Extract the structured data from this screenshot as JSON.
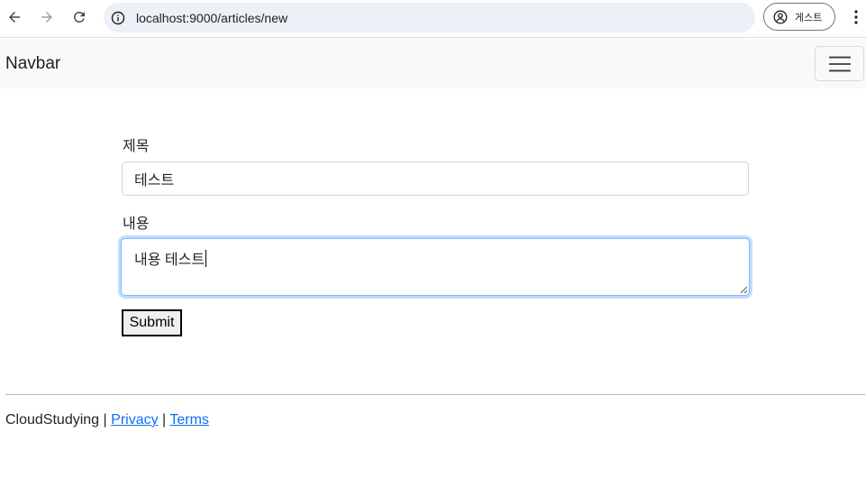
{
  "browser": {
    "url": "localhost:9000/articles/new",
    "profile_label": "게스트",
    "icons": [
      "back-arrow-icon",
      "forward-arrow-icon",
      "reload-icon",
      "site-info-icon",
      "profile-icon",
      "kebab-menu-icon"
    ]
  },
  "navbar": {
    "brand": "Navbar",
    "toggler_icon": "hamburger-icon"
  },
  "form": {
    "title_label": "제목",
    "title_value": "테스트",
    "content_label": "내용",
    "content_value": "내용 테스트",
    "submit_label": "Submit"
  },
  "footer": {
    "company": "CloudStudying",
    "separator": "|",
    "privacy_label": "Privacy",
    "terms_label": "Terms"
  },
  "colors": {
    "link": "#0d6efd",
    "focus_border": "#86b7fe",
    "navbar_bg": "#f8f9fa",
    "omnibox_bg": "#eef0f8"
  }
}
